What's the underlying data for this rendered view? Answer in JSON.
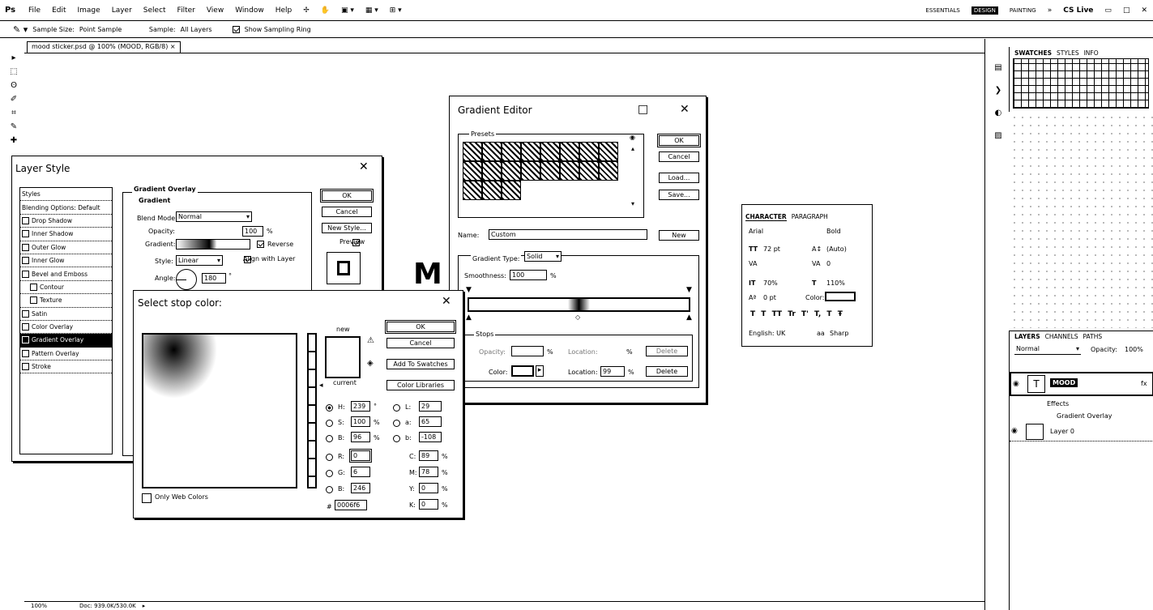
{
  "app": {
    "logo": "Ps",
    "menus": [
      "File",
      "Edit",
      "Image",
      "Layer",
      "Select",
      "Filter",
      "View",
      "Window",
      "Help"
    ],
    "workspace": [
      "ESSENTIALS",
      "DESIGN",
      "PAINTING"
    ],
    "cs_live": "CS Live"
  },
  "options": {
    "sample_size_label": "Sample Size:",
    "sample_size_value": "Point Sample",
    "sample_label": "Sample:",
    "sample_value": "All Layers",
    "show_ring": "Show Sampling Ring"
  },
  "document": {
    "tab": "mood sticker.psd @ 100% (MOOD, RGB/8)",
    "close": "×",
    "canvas_text": "M",
    "status_zoom": "100%",
    "status_doc": "Doc: 939.0K/530.0K"
  },
  "layer_style": {
    "title": "Layer Style",
    "styles_header": "Styles",
    "items": [
      "Blending Options: Default",
      "Drop Shadow",
      "Inner Shadow",
      "Outer Glow",
      "Inner Glow",
      "Bevel and Emboss",
      "Contour",
      "Texture",
      "Satin",
      "Color Overlay",
      "Gradient Overlay",
      "Pattern Overlay",
      "Stroke"
    ],
    "section": "Gradient Overlay",
    "subsection": "Gradient",
    "blend_mode_label": "Blend Mode:",
    "blend_mode": "Normal",
    "opacity_label": "Opacity:",
    "opacity": "100",
    "percent": "%",
    "gradient_label": "Gradient:",
    "reverse": "Reverse",
    "style_label": "Style:",
    "style": "Linear",
    "align": "Align with Layer",
    "angle_label": "Angle:",
    "angle": "180",
    "degree": "°",
    "ok": "OK",
    "cancel": "Cancel",
    "new_style": "New Style...",
    "preview": "Preview"
  },
  "stop_color": {
    "title": "Select stop color:",
    "new_label": "new",
    "current_label": "current",
    "ok": "OK",
    "cancel": "Cancel",
    "add_swatches": "Add To Swatches",
    "color_libraries": "Color Libraries",
    "fields": {
      "H": "239",
      "S": "100",
      "B": "96",
      "R": "0",
      "G": "6",
      "Bl": "246",
      "L": "29",
      "a": "65",
      "b": "-108",
      "C": "89",
      "M": "78",
      "Y": "0",
      "K": "0"
    },
    "labels": {
      "H": "H:",
      "S": "S:",
      "B": "B:",
      "R": "R:",
      "G": "G:",
      "Bl": "B:",
      "L": "L:",
      "a": "a:",
      "b": "b:",
      "C": "C:",
      "M": "M:",
      "Y": "Y:",
      "K": "K:"
    },
    "deg": "°",
    "pct": "%",
    "hash": "#",
    "hex": "0006f6",
    "web_only": "Only Web Colors"
  },
  "gradient_editor": {
    "title": "Gradient Editor",
    "presets": "Presets",
    "ok": "OK",
    "cancel": "Cancel",
    "load": "Load...",
    "save": "Save...",
    "name_label": "Name:",
    "name": "Custom",
    "new": "New",
    "type_label": "Gradient Type:",
    "type": "Solid",
    "smooth_label": "Smoothness:",
    "smooth": "100",
    "pct": "%",
    "stops": "Stops",
    "opacity_label": "Opacity:",
    "location_label": "Location:",
    "delete": "Delete",
    "color_label": "Color:",
    "location": "99"
  },
  "character": {
    "tab1": "CHARACTER",
    "tab2": "PARAGRAPH",
    "font": "Arial",
    "weight": "Bold",
    "size": "72 pt",
    "leading": "(Auto)",
    "kerning": "",
    "tracking": "0",
    "vscale": "70%",
    "hscale": "110%",
    "baseline": "0 pt",
    "color_label": "Color:",
    "glyphs": [
      "T",
      "T",
      "TT",
      "Tr",
      "T'",
      "T,",
      "T",
      "Ŧ"
    ],
    "lang": "English: UK",
    "aa_icon": "aa",
    "aa": "Sharp"
  },
  "swatches": {
    "tabs": [
      "SWATCHES",
      "STYLES",
      "INFO"
    ]
  },
  "layers": {
    "tabs": [
      "LAYERS",
      "CHANNELS",
      "PATHS"
    ],
    "blend": "Normal",
    "opacity_label": "Opacity:",
    "opacity": "100%",
    "rows": [
      {
        "name": "MOOD",
        "icon": "T"
      },
      {
        "name": "Effects"
      },
      {
        "name": "Gradient Overlay"
      },
      {
        "name": "Layer 0"
      }
    ]
  },
  "colors": {
    "ink": "#000000",
    "paper": "#ffffff",
    "picked": "#0006f6"
  }
}
